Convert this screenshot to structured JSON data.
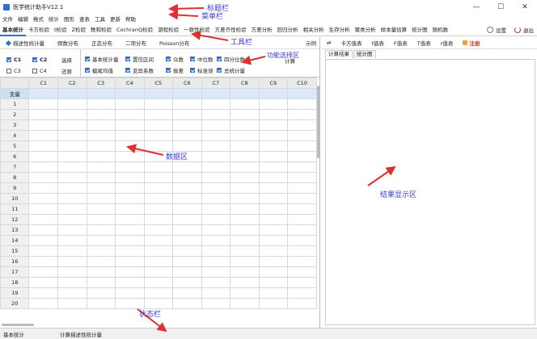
{
  "window": {
    "title": "医学统计助手V12.1",
    "minimize": "—",
    "maximize": "☐",
    "close": "✕"
  },
  "menu": [
    "文件",
    "编辑",
    "格式",
    "统计",
    "图形",
    "查表",
    "工具",
    "更新",
    "帮助"
  ],
  "toolbar": {
    "items": [
      "基本统计",
      "卡方检验",
      "t检验",
      "Z检验",
      "秩和检验",
      "CochranQ检验",
      "游程检验",
      "一致性检验",
      "方差齐性检验",
      "方差分析",
      "回归分析",
      "相关分析",
      "生存分析",
      "聚类分析",
      "样本量估算",
      "统计图",
      "随机数"
    ],
    "settings": "设置",
    "exit": "退出"
  },
  "subtabs": {
    "items": [
      "描述性统计量",
      "频数分布",
      "正态分布",
      "二项分布",
      "Poisson分布"
    ],
    "example": "示例"
  },
  "func": {
    "cols": [
      {
        "label": "C1",
        "checked": true
      },
      {
        "label": "C2",
        "checked": true
      },
      {
        "label": "C3",
        "checked": false
      },
      {
        "label": "C4",
        "checked": false
      }
    ],
    "select": "选择",
    "restore": "还原",
    "options": [
      {
        "label": "基本统计量",
        "checked": true
      },
      {
        "label": "置信区间",
        "checked": true
      },
      {
        "label": "众数",
        "checked": true
      },
      {
        "label": "中位数",
        "checked": true
      },
      {
        "label": "四分位数",
        "checked": true
      },
      {
        "label": "截尾均值",
        "checked": true
      },
      {
        "label": "变异系数",
        "checked": true
      },
      {
        "label": "极差",
        "checked": true
      },
      {
        "label": "标准误",
        "checked": true
      },
      {
        "label": "总统计量",
        "checked": true
      }
    ],
    "compute": "计算"
  },
  "grid": {
    "columns": [
      "C1",
      "C2",
      "C3",
      "C4",
      "C5",
      "C6",
      "C7",
      "C8",
      "C9",
      "C10"
    ],
    "var_row": "变量",
    "rows": [
      "1",
      "2",
      "3",
      "4",
      "5",
      "6",
      "7",
      "8",
      "9",
      "10",
      "11",
      "12",
      "13",
      "14",
      "15",
      "16",
      "17",
      "18",
      "19",
      "20"
    ]
  },
  "right": {
    "toolbar": [
      "卡方值表",
      "t值表",
      "F值表",
      "T值表",
      "r值表"
    ],
    "register": "注册",
    "tabs": [
      "计算结果",
      "统计图"
    ]
  },
  "status": {
    "left": "基本统计",
    "right": "计算描述性统计量"
  },
  "annotations": {
    "title": "标题栏",
    "menu": "菜单栏",
    "toolbar": "工具栏",
    "func": "功能选择区",
    "data": "数据区",
    "result": "结果显示区",
    "status": "状态栏"
  },
  "colors": {
    "accent": "#2f6fd0",
    "annotation": "#3b3bd0",
    "arrow": "#e03030",
    "register": "#d32222"
  }
}
